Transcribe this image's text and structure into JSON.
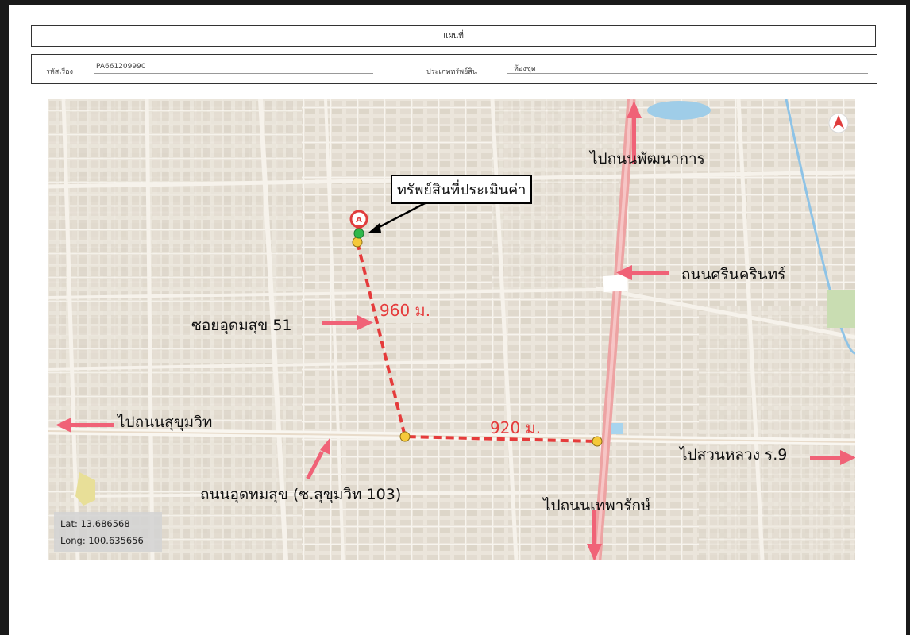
{
  "header": {
    "title": "แผนที่",
    "case_label": "รหัสเรื่อง",
    "case_value": "PA661209990",
    "type_label": "ประเภททรัพย์สิน",
    "type_value": "ห้องชุด"
  },
  "map": {
    "property_label": "ทรัพย์สินที่ประเมินค่า",
    "labels": {
      "to_pattanakarn": "ไปถนนพัฒนาการ",
      "srinakarin": "ถนนศรีนครินทร์",
      "soi_udomsuk_51": "ซอยอุดมสุข 51",
      "to_sukhumvit": "ไปถนนสุขุมวิท",
      "udomsuk_road": "ถนนอุดทมสุข (ซ.สุขุมวิท 103)",
      "to_thepharak": "ไปถนนเทพารักษ์",
      "to_suan_luang": "ไปสวนหลวง ร.9"
    },
    "distances": {
      "segment_1": "960 ม.",
      "segment_2": "920 ม."
    },
    "marker_letter": "A",
    "compass_icon": "compass-north-icon",
    "coordinates": {
      "lat": "Lat: 13.686568",
      "long": "Long: 100.635656"
    },
    "colors": {
      "arrow": "#f06277",
      "route": "#e53b3b",
      "main_road": "#f0a8a8",
      "waypoint": "#f5c93a",
      "property": "#2fb84a",
      "marker": "#e03c3c"
    }
  }
}
